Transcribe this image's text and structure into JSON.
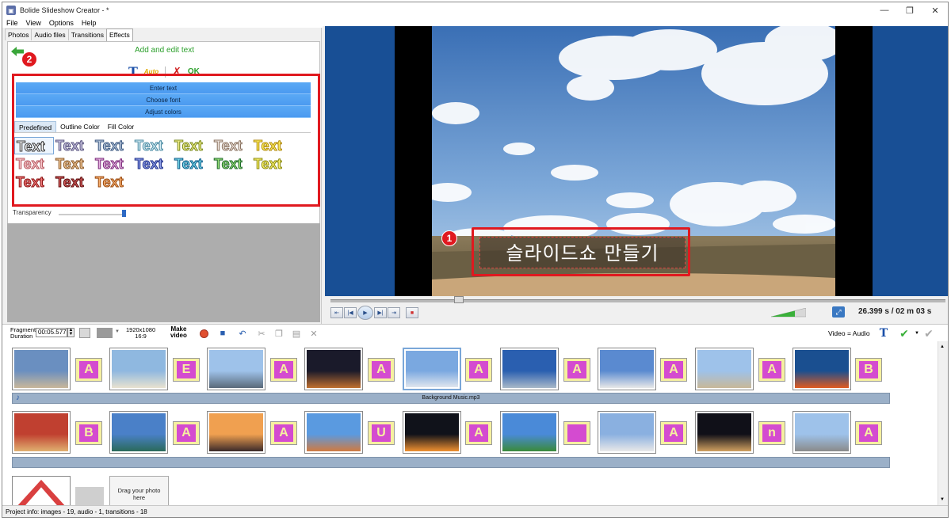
{
  "window": {
    "title": "Bolide Slideshow Creator - *",
    "minimize": "—",
    "restore": "❐",
    "close": "✕"
  },
  "menu": [
    "File",
    "View",
    "Options",
    "Help"
  ],
  "tabs": [
    "Photos",
    "Audio files",
    "Transitions",
    "Effects"
  ],
  "effects": {
    "heading": "Add and edit text",
    "tools": {
      "text_icon": "T",
      "auto": "Auto",
      "delete": "✗",
      "ok": "OK"
    },
    "accordion": [
      "Enter text",
      "Choose font",
      "Adjust colors"
    ],
    "subtabs": [
      "Predefined",
      "Outline Color",
      "Fill Color"
    ],
    "styles": [
      {
        "label": "Text",
        "fill": "#ffffff",
        "stroke": "#3a3a3a"
      },
      {
        "label": "Text",
        "fill": "#c9c3e0",
        "stroke": "#5a5680"
      },
      {
        "label": "Text",
        "fill": "#b8c7dc",
        "stroke": "#3d5a82"
      },
      {
        "label": "Text",
        "fill": "#d6eef5",
        "stroke": "#4a8aa2"
      },
      {
        "label": "Text",
        "fill": "#f4f08a",
        "stroke": "#7a8a20"
      },
      {
        "label": "Text",
        "fill": "#efe6e0",
        "stroke": "#8a7260"
      },
      {
        "label": "Text",
        "fill": "#fff15c",
        "stroke": "#b08a10"
      },
      {
        "label": "Text",
        "fill": "#f6c8cc",
        "stroke": "#b85a62"
      },
      {
        "label": "Text",
        "fill": "#f0c696",
        "stroke": "#8a5a2a"
      },
      {
        "label": "Text",
        "fill": "#e6b4e0",
        "stroke": "#7a2a7a"
      },
      {
        "label": "Text",
        "fill": "#8fa0e8",
        "stroke": "#1e2f8a"
      },
      {
        "label": "Text",
        "fill": "#78d8e8",
        "stroke": "#0b5a88"
      },
      {
        "label": "Text",
        "fill": "#9be07a",
        "stroke": "#1d6a2a"
      },
      {
        "label": "Text",
        "fill": "#fff56e",
        "stroke": "#8a8a10"
      },
      {
        "label": "Text",
        "fill": "#f07a7a",
        "stroke": "#8a1010"
      },
      {
        "label": "Text",
        "fill": "#d25a5a",
        "stroke": "#5a0a0a"
      },
      {
        "label": "Text",
        "fill": "#f8b070",
        "stroke": "#9a4a10"
      }
    ],
    "transparency_label": "Transparency"
  },
  "badges": {
    "one": "1",
    "two": "2"
  },
  "preview": {
    "caption": "슬라이드쇼 만들기",
    "time": "26.399 s  / 02 m 03 s",
    "controls": [
      "⇤",
      "|◀",
      "▶",
      "▶|",
      "⇥",
      "■"
    ]
  },
  "toolbar": {
    "fragment_label_1": "Fragment",
    "fragment_label_2": "Duration",
    "fragment_value": "00:05.577",
    "resolution_1": "1920x1080",
    "resolution_2": "16:9",
    "make_video_1": "Make",
    "make_video_2": "video",
    "video_audio": "Video = Audio",
    "text_tool": "T"
  },
  "storyboard": {
    "audio_track": "Background Music.mp3",
    "drag_1": "Drag your photo",
    "drag_2": "here",
    "row1_transitions": [
      "A",
      "E",
      "A",
      "A",
      "A",
      "A",
      "A",
      "A",
      "B"
    ],
    "row2_transitions": [
      "B",
      "A",
      "A",
      "U",
      "A",
      "",
      "A",
      "n",
      "A"
    ]
  },
  "status": "Project info: images - 19, audio - 1, transitions - 18",
  "colors": {
    "accent_red": "#e0191f",
    "accordion_blue": "#4b9af0",
    "stage_blue": "#184f95",
    "heading_green": "#2ca02c"
  }
}
